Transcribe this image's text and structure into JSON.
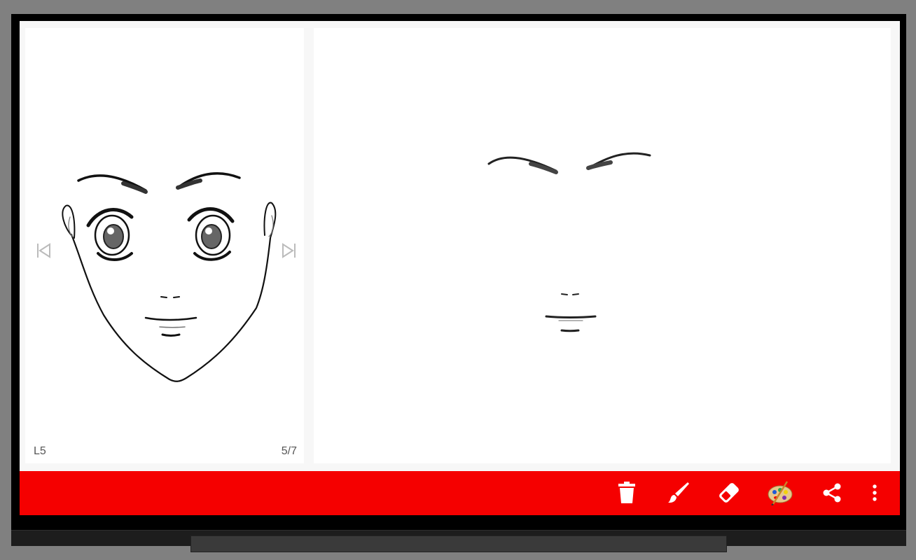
{
  "reference": {
    "level_label": "L5",
    "page_counter": "5/7"
  },
  "nav": {
    "prev_icon": "skip-previous-icon",
    "next_icon": "skip-next-icon"
  },
  "toolbar": {
    "color": "#f50000",
    "tools": [
      {
        "name": "delete",
        "icon": "trash-icon"
      },
      {
        "name": "brush",
        "icon": "brush-icon"
      },
      {
        "name": "eraser",
        "icon": "eraser-icon"
      },
      {
        "name": "palette",
        "icon": "palette-icon"
      },
      {
        "name": "share",
        "icon": "share-icon"
      },
      {
        "name": "more",
        "icon": "more-vertical-icon"
      }
    ]
  }
}
